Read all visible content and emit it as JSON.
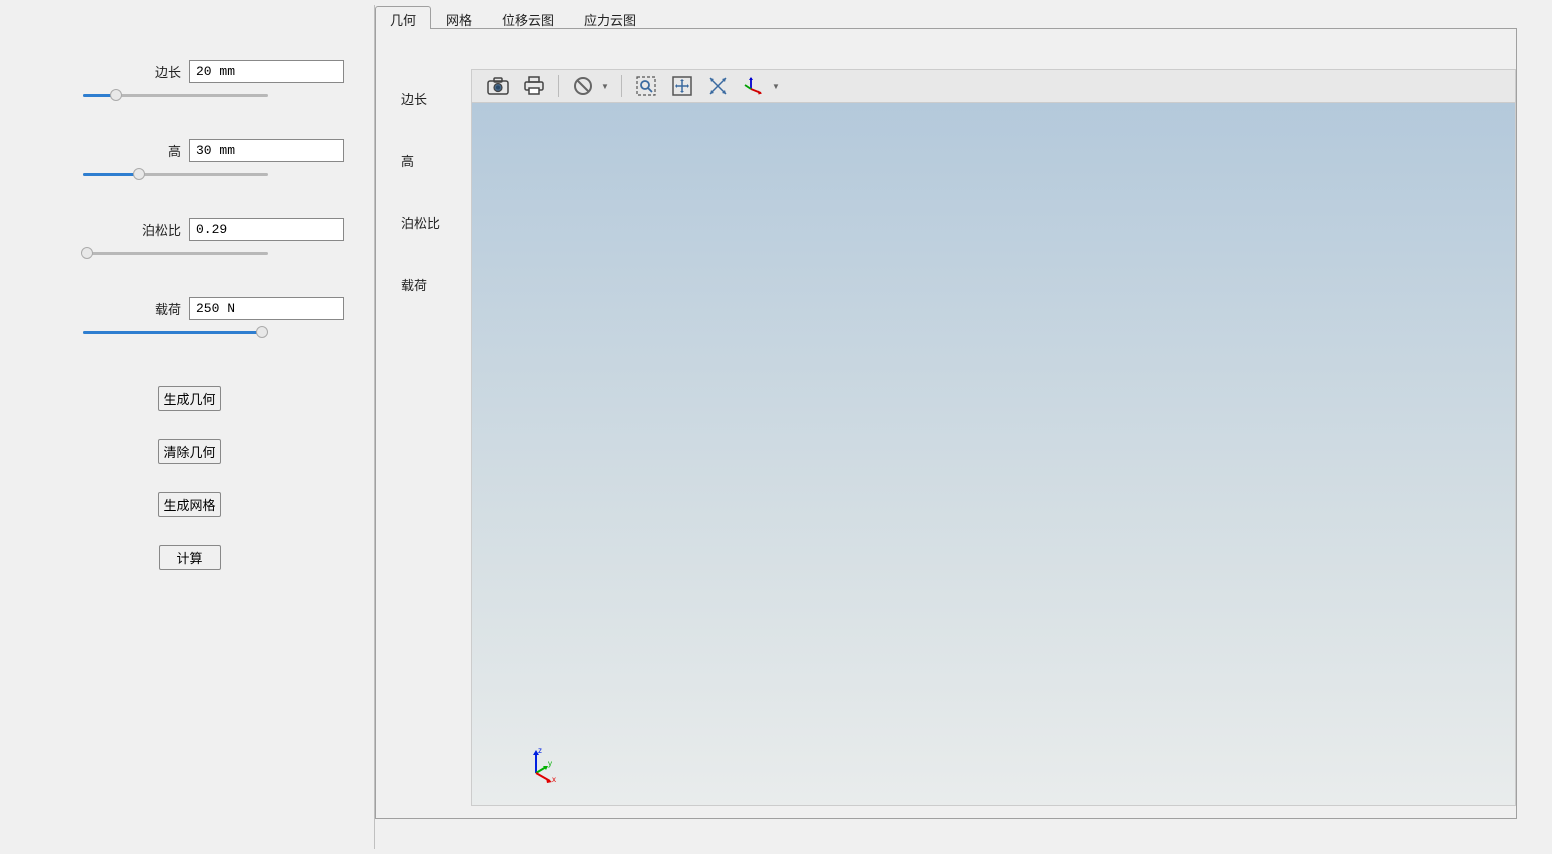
{
  "params": {
    "side": {
      "label": "边长",
      "value": "20 mm",
      "slider_pct": 18
    },
    "height": {
      "label": "高",
      "value": "30 mm",
      "slider_pct": 30
    },
    "poisson": {
      "label": "泊松比",
      "value": "0.29",
      "slider_pct": 2
    },
    "load": {
      "label": "载荷",
      "value": "250 N",
      "slider_pct": 97
    }
  },
  "buttons": {
    "gen_geom": "生成几何",
    "clear_geom": "清除几何",
    "gen_mesh": "生成网格",
    "compute": "计算"
  },
  "tabs": {
    "geometry": "几何",
    "mesh": "网格",
    "disp_cloud": "位移云图",
    "stress_cloud": "应力云图"
  },
  "sub_labels": {
    "side": "边长",
    "height": "高",
    "poisson": "泊松比",
    "load": "载荷"
  },
  "axes": {
    "x": "x",
    "y": "y",
    "z": "z"
  }
}
